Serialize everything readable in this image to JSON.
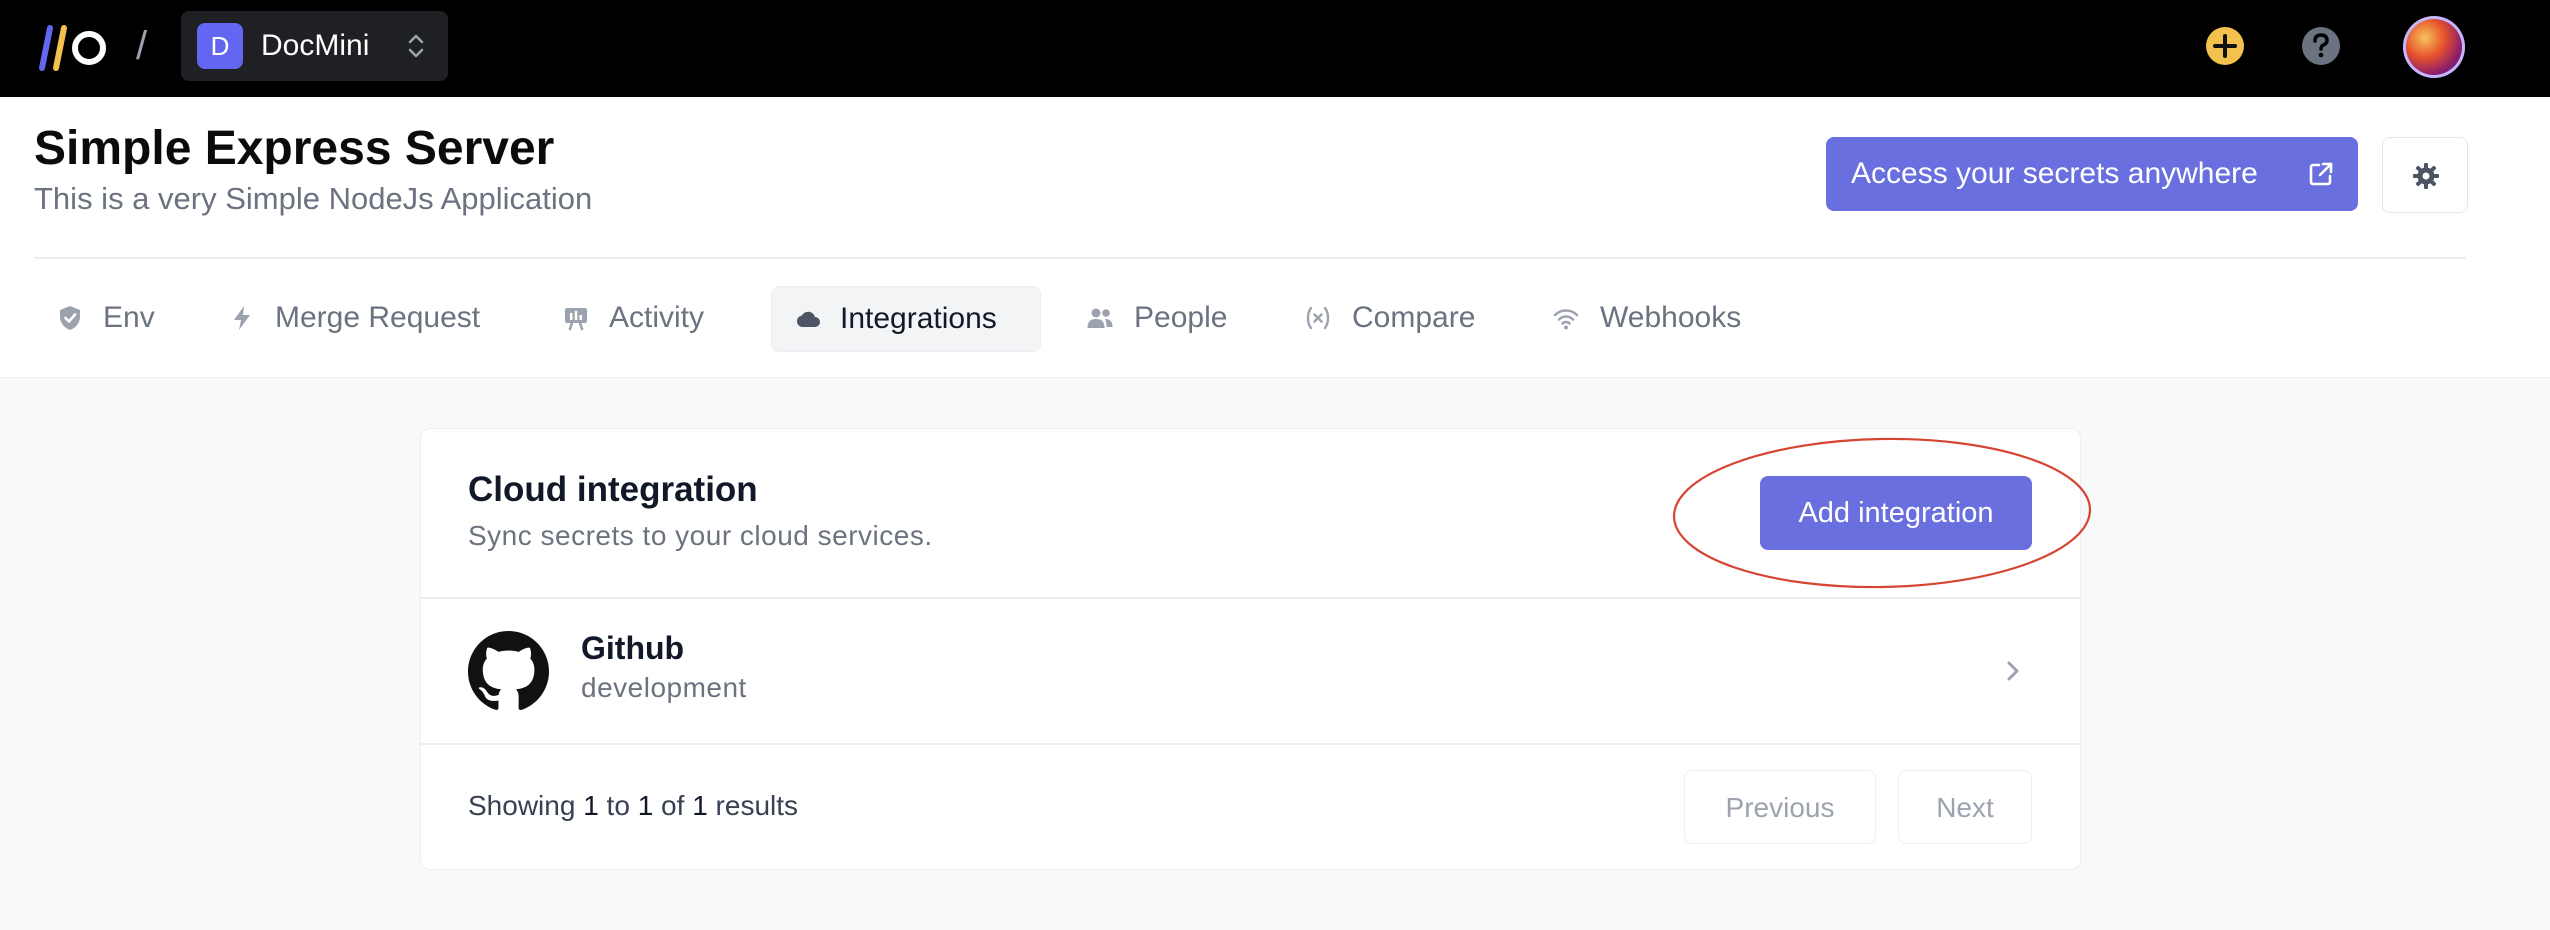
{
  "topbar": {
    "separator": "/",
    "org": {
      "initial": "D",
      "name": "DocMini"
    },
    "colors": {
      "accent": "#6366f1",
      "add_icon": "#f2c14e"
    }
  },
  "project": {
    "title": "Simple Express Server",
    "subtitle": "This is a very Simple NodeJs Application",
    "access_button": "Access your secrets anywhere"
  },
  "tabs": [
    {
      "label": "Env",
      "icon": "shield-check-icon",
      "active": false
    },
    {
      "label": "Merge Request",
      "icon": "bolt-icon",
      "active": false
    },
    {
      "label": "Activity",
      "icon": "presentation-chart-icon",
      "active": false
    },
    {
      "label": "Integrations",
      "icon": "cloud-icon",
      "active": true
    },
    {
      "label": "People",
      "icon": "users-icon",
      "active": false
    },
    {
      "label": "Compare",
      "icon": "variable-icon",
      "active": false
    },
    {
      "label": "Webhooks",
      "icon": "wifi-icon",
      "active": false
    }
  ],
  "card": {
    "title": "Cloud integration",
    "subtitle": "Sync secrets to your cloud services.",
    "add_button": "Add integration",
    "integrations": [
      {
        "name": "Github",
        "environment": "development",
        "icon": "github-icon"
      }
    ],
    "results": {
      "prefix": "Showing",
      "from": "1",
      "to_word": "to",
      "to": "1",
      "of_word": "of",
      "total": "1",
      "suffix": "results"
    },
    "pagination": {
      "previous": "Previous",
      "next": "Next"
    }
  }
}
